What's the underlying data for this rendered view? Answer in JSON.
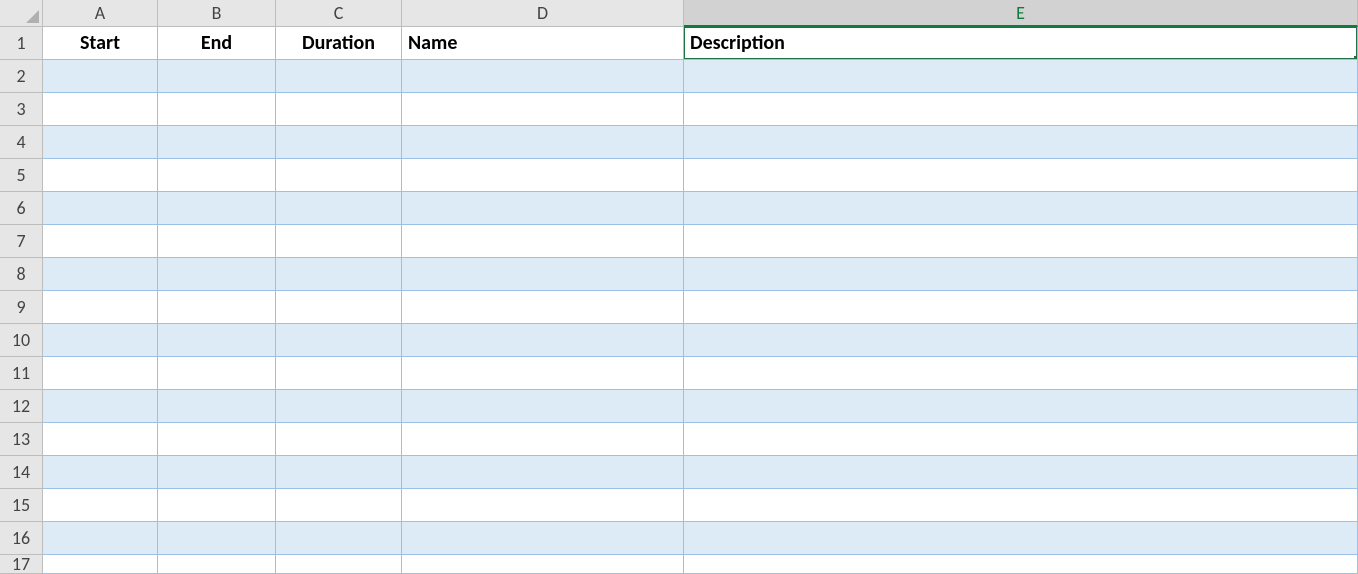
{
  "columns": [
    {
      "letter": "A",
      "header": "Start",
      "align": "center",
      "selected": false
    },
    {
      "letter": "B",
      "header": "End",
      "align": "center",
      "selected": false
    },
    {
      "letter": "C",
      "header": "Duration",
      "align": "center",
      "selected": false
    },
    {
      "letter": "D",
      "header": "Name",
      "align": "left",
      "selected": false
    },
    {
      "letter": "E",
      "header": "Description",
      "align": "left",
      "selected": true
    }
  ],
  "rowCount": 16,
  "activeCell": {
    "row": 1,
    "col": "E"
  }
}
